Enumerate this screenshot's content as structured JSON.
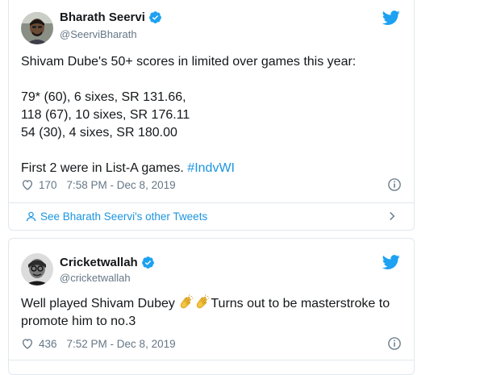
{
  "tweets": [
    {
      "author_name": "Bharath Seervi",
      "author_handle": "@SeerviBharath",
      "body": {
        "line1": "Shivam Dube's 50+ scores in limited over games this year:",
        "line2": "79* (60), 6 sixes, SR 131.66,",
        "line3": "118 (67), 10 sixes, SR 176.11",
        "line4": "54 (30), 4 sixes, SR 180.00",
        "line5": "First 2 were in List-A games.",
        "hashtag": "#IndvWI"
      },
      "likes": "170",
      "timestamp": "7:58 PM - Dec 8, 2019",
      "see_more": "See Bharath Seervi's other Tweets"
    },
    {
      "author_name": "Cricketwallah",
      "author_handle": "@cricketwallah",
      "body": {
        "part1": "Well played Shivam Dubey",
        "part2": "Turns out to be masterstroke to",
        "line2": "promote him to no.3"
      },
      "likes": "436",
      "timestamp": "7:52 PM - Dec 8, 2019"
    }
  ],
  "icons": {
    "verified": "verified-badge-icon",
    "bird": "twitter-bird-icon",
    "heart": "heart-icon",
    "info": "info-icon",
    "person": "person-icon",
    "chevron": "chevron-right-icon",
    "clap": "clapping-hands-emoji"
  },
  "colors": {
    "accent": "#1da1f2",
    "link": "#1b95e0",
    "muted": "#657786",
    "border": "#e1e8ed"
  }
}
